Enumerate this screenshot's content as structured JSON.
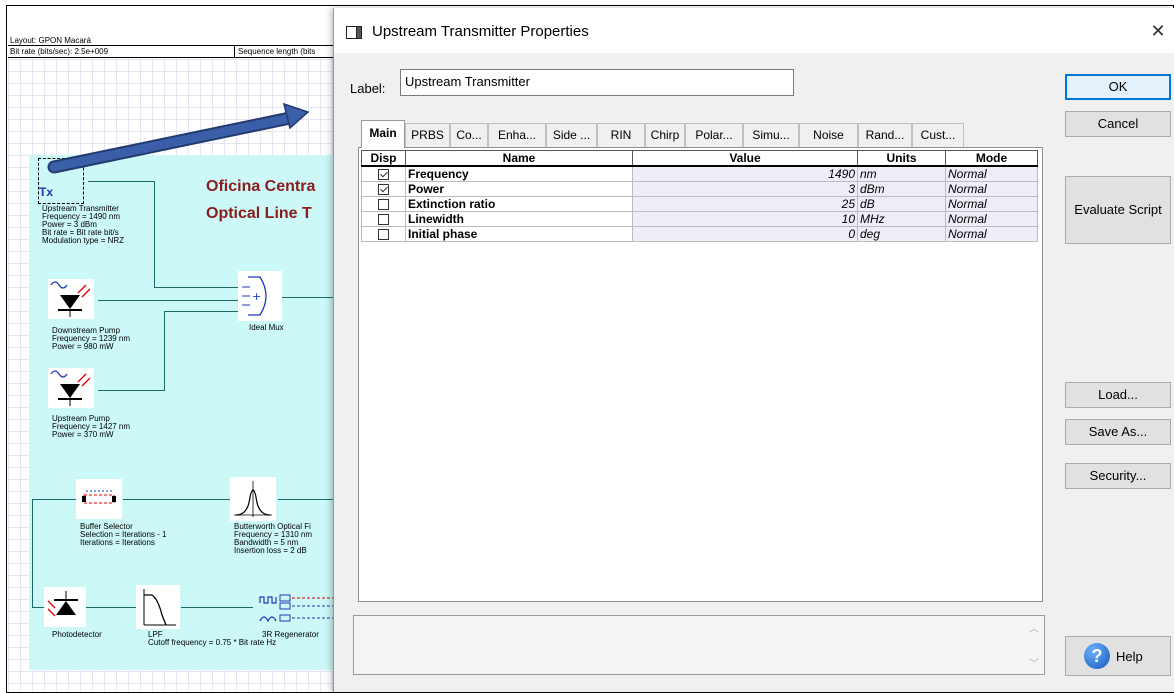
{
  "canvas": {
    "layout_name": "Layout: GPON Macará",
    "bit_rate": "Bit rate (bits/sec):  2.5e+009",
    "sequence_length": "Sequence length (bits",
    "office_line1": "Oficina Centra",
    "office_line2": "Optical Line T",
    "components": {
      "tx": [
        "Upstream Transmitter",
        "Frequency = 1490  nm",
        "Power = 3  dBm",
        "Bit rate = Bit rate  bit/s",
        "Modulation type = NRZ"
      ],
      "tx_icon": "Tx",
      "downstream_pump": [
        "Downstream Pump",
        "Frequency = 1239  nm",
        "Power = 980  mW"
      ],
      "upstream_pump": [
        "Upstream Pump",
        "Frequency = 1427  nm",
        "Power = 370  mW"
      ],
      "mux": "Ideal Mux",
      "buffer": [
        "Buffer Selector",
        "Selection = Iterations - 1",
        "Iterations = Iterations"
      ],
      "butterworth": [
        "Butterworth Optical Fi",
        "Frequency = 1310  nm",
        "Bandwidth = 5  nm",
        "Insertion loss = 2  dB"
      ],
      "photodetector": "Photodetector",
      "lpf": [
        "LPF",
        "Cutoff frequency = 0.75 * Bit rate  Hz"
      ],
      "regenerator": "3R Regenerator"
    }
  },
  "dialog": {
    "title": "Upstream Transmitter Properties",
    "close_glyph": "✕",
    "label_caption": "Label:",
    "label_value": "Upstream Transmitter",
    "tabs": [
      "Main",
      "PRBS",
      "Co...",
      "Enha...",
      "Side ...",
      "RIN",
      "Chirp",
      "Polar...",
      "Simu...",
      "Noise",
      "Rand...",
      "Cust..."
    ],
    "table": {
      "headers": [
        "Disp",
        "Name",
        "Value",
        "Units",
        "Mode"
      ],
      "rows": [
        {
          "disp": true,
          "name": "Frequency",
          "value": "1490",
          "units": "nm",
          "mode": "Normal"
        },
        {
          "disp": true,
          "name": "Power",
          "value": "3",
          "units": "dBm",
          "mode": "Normal"
        },
        {
          "disp": false,
          "name": "Extinction ratio",
          "value": "25",
          "units": "dB",
          "mode": "Normal"
        },
        {
          "disp": false,
          "name": "Linewidth",
          "value": "10",
          "units": "MHz",
          "mode": "Normal"
        },
        {
          "disp": false,
          "name": "Initial phase",
          "value": "0",
          "units": "deg",
          "mode": "Normal"
        }
      ]
    },
    "buttons": {
      "ok": "OK",
      "cancel": "Cancel",
      "evaluate": "Evaluate Script",
      "load": "Load...",
      "save_as": "Save As...",
      "security": "Security...",
      "help": "Help",
      "help_glyph": "?"
    },
    "scroll_up": "︿",
    "scroll_down": "﹀"
  },
  "colors": {
    "arrow": "#3a5fa8",
    "office_title": "#8b1c1c",
    "canvas_area": "#ccf8f8",
    "ok_border": "#0078d7"
  }
}
